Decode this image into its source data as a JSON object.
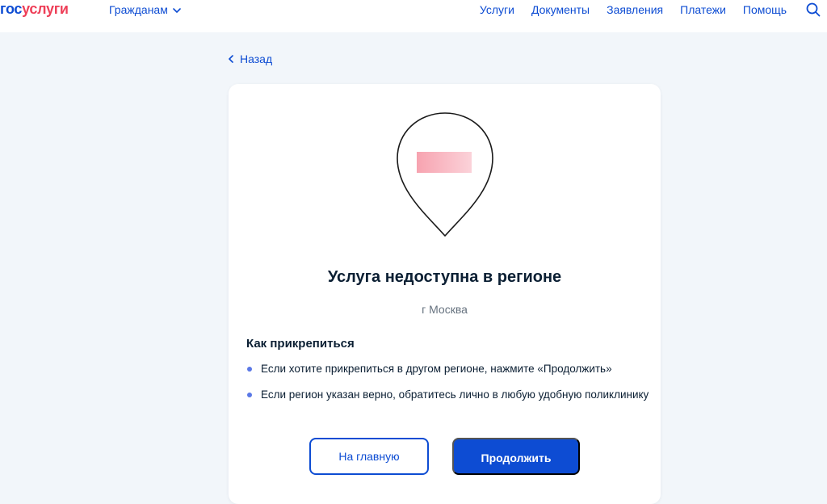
{
  "header": {
    "logo_part1": "гос",
    "logo_part2": "услуги",
    "audience_label": "Гражданам",
    "nav": [
      "Услуги",
      "Документы",
      "Заявления",
      "Платежи",
      "Помощь"
    ]
  },
  "back_label": "Назад",
  "card": {
    "title": "Услуга недоступна в регионе",
    "region": "г Москва",
    "howto_heading": "Как прикрепиться",
    "items": [
      "Если хотите прикрепиться в другом регионе, нажмите «Продолжить»",
      "Если регион указан верно, обратитесь лично в любую удобную поликлинику"
    ],
    "home_button": "На главную",
    "continue_button": "Продолжить"
  },
  "colors": {
    "brand_blue": "#0d4cd3",
    "brand_red": "#ee3f58",
    "background": "#f2f6fa"
  }
}
